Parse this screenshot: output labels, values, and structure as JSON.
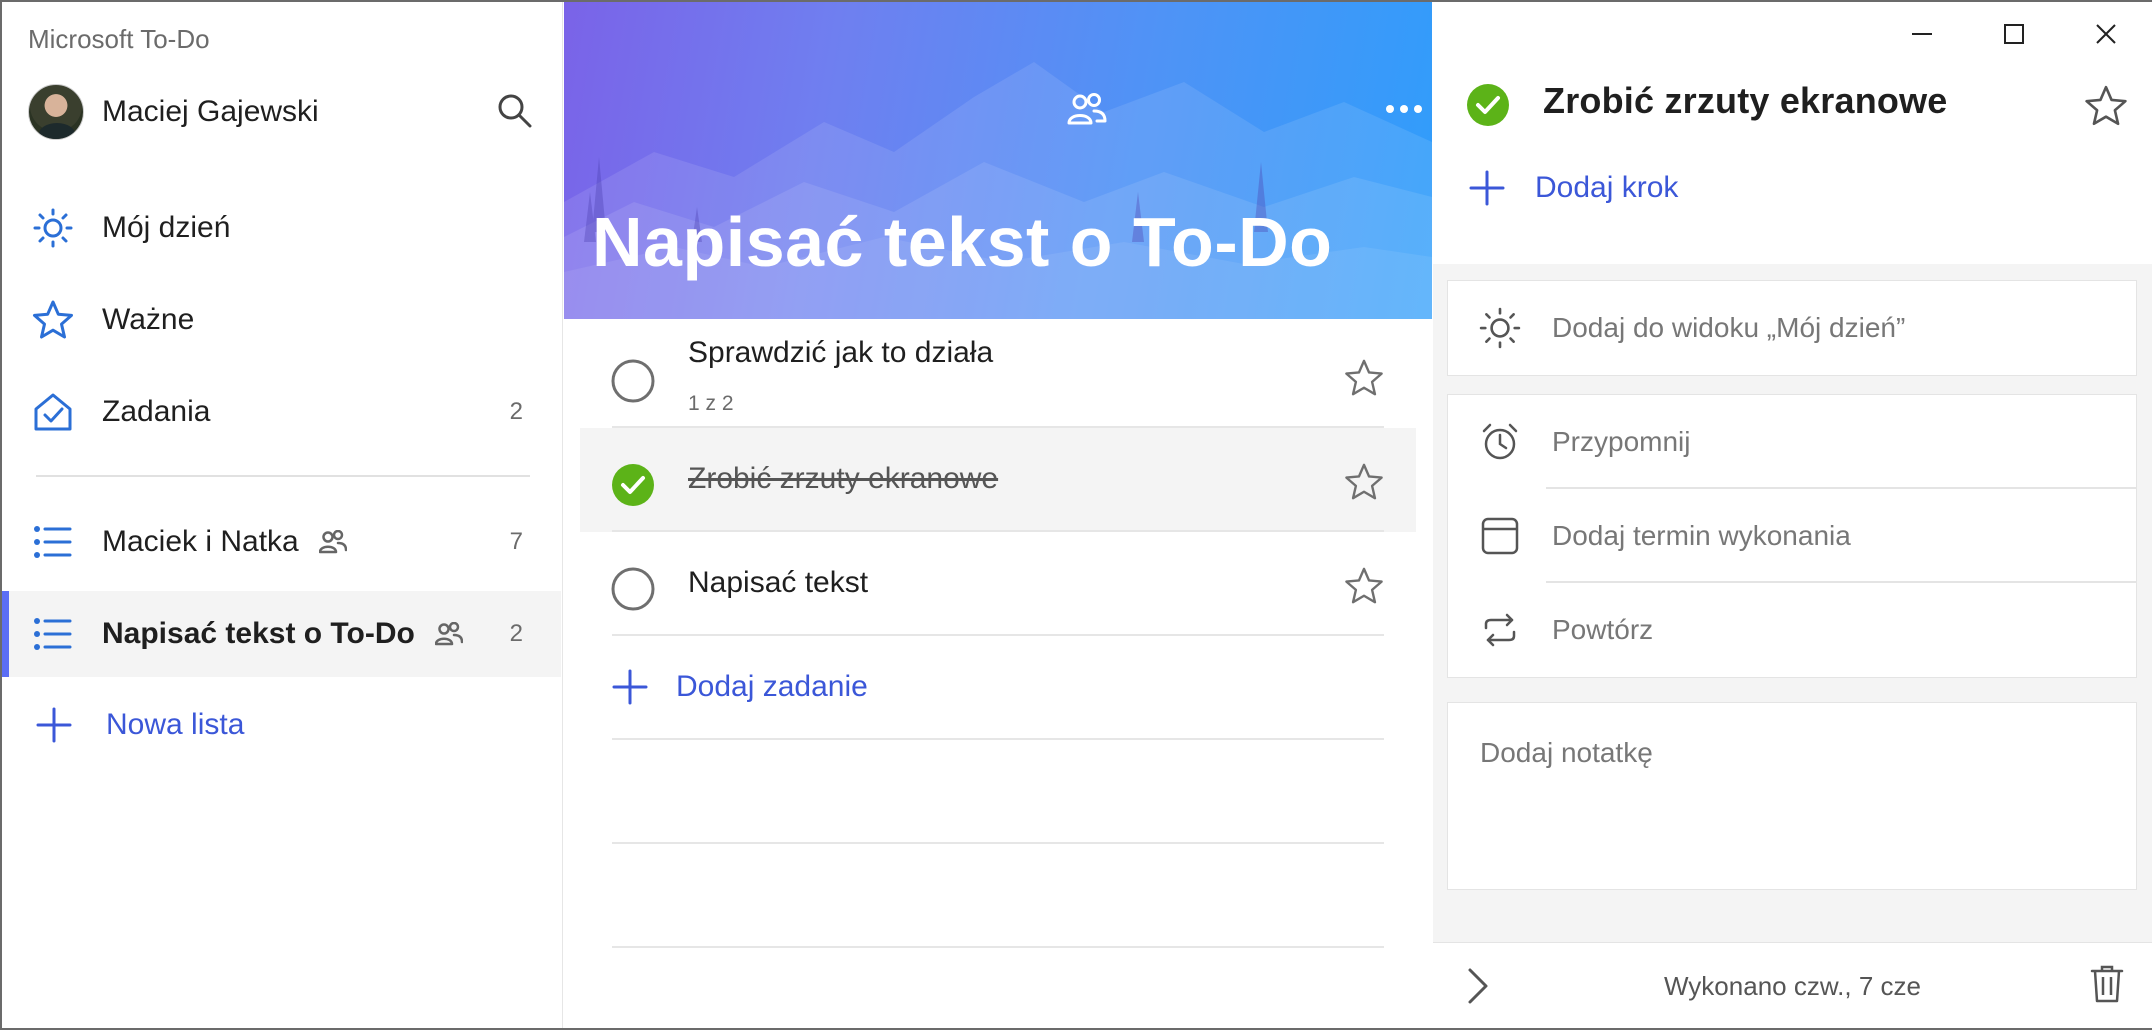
{
  "app": {
    "title": "Microsoft To-Do"
  },
  "user": {
    "name": "Maciej Gajewski"
  },
  "sidebar": {
    "smart_lists": [
      {
        "label": "Mój dzień",
        "icon": "sun-icon",
        "count": ""
      },
      {
        "label": "Ważne",
        "icon": "star-icon",
        "count": ""
      },
      {
        "label": "Zadania",
        "icon": "house-check-icon",
        "count": "2"
      }
    ],
    "lists": [
      {
        "label": "Maciek i Natka",
        "icon": "list-icon",
        "shared": true,
        "count": "7"
      },
      {
        "label": "Napisać tekst o To-Do",
        "icon": "list-icon",
        "shared": true,
        "count": "2",
        "selected": true
      }
    ],
    "new_list_label": "Nowa lista"
  },
  "main": {
    "title": "Napisać tekst o To-Do",
    "tasks": [
      {
        "title": "Sprawdzić jak to działa",
        "subtitle": "1 z 2",
        "completed": false,
        "starred": false
      },
      {
        "title": "Zrobić zrzuty ekranowe",
        "subtitle": "",
        "completed": true,
        "starred": false,
        "selected": true
      },
      {
        "title": "Napisać tekst",
        "subtitle": "",
        "completed": false,
        "starred": false
      }
    ],
    "add_task_label": "Dodaj zadanie"
  },
  "detail": {
    "title": "Zrobić zrzuty ekranowe",
    "completed": true,
    "add_step_label": "Dodaj krok",
    "my_day_label": "Dodaj do widoku „Mój dzień”",
    "remind_label": "Przypomnij",
    "due_label": "Dodaj termin wykonania",
    "repeat_label": "Powtórz",
    "note_placeholder": "Dodaj notatkę",
    "footer_status": "Wykonano czw., 7 cze"
  },
  "colors": {
    "accent": "#3b57d8",
    "complete_green": "#5cb318",
    "hero_gradient_start": "#7a63e8",
    "hero_gradient_end": "#2f9dfb"
  }
}
